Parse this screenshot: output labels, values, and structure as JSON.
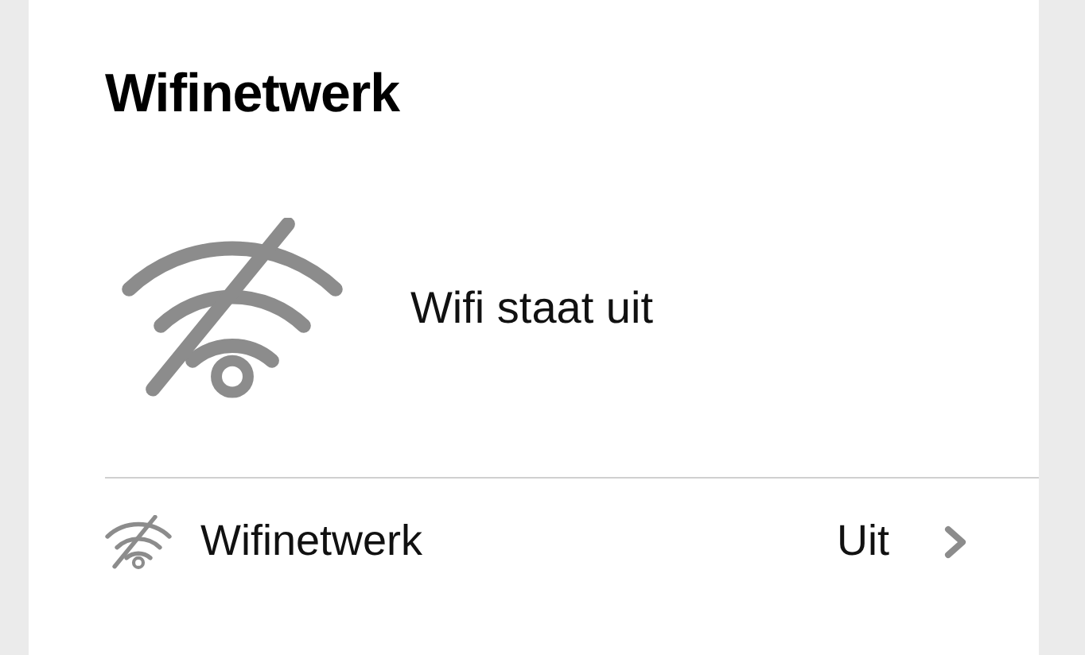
{
  "title": "Wifinetwerk",
  "status": {
    "text": "Wifi staat uit"
  },
  "rows": [
    {
      "label": "Wifinetwerk",
      "value": "Uit"
    }
  ]
}
